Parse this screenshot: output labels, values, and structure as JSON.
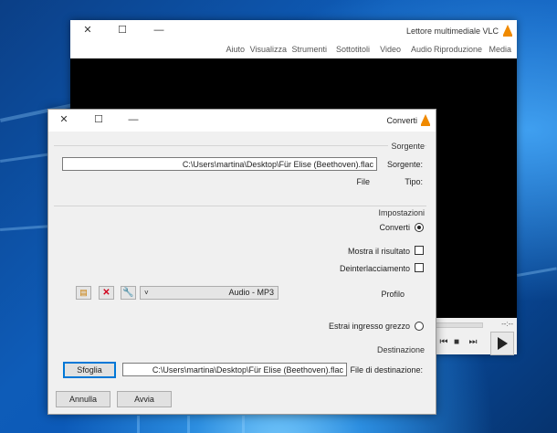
{
  "vlc_window": {
    "title": "Lettore multimediale VLC",
    "menu": [
      "Media",
      "Riproduzione",
      "Audio",
      "Video",
      "Sottotitoli",
      "Strumenti",
      "Visualizza",
      "Aiuto"
    ],
    "time_readout": "--:--"
  },
  "dialog": {
    "title": "Converti",
    "source": {
      "group_label": "Sorgente",
      "source_label": "Sorgente:",
      "source_value": "C:\\Users\\martina\\Desktop\\Für Elise (Beethoven).flac",
      "type_label": "Tipo:",
      "type_value": "File"
    },
    "settings": {
      "group_label": "Impostazioni",
      "convert_label": "Converti",
      "show_result_label": "Mostra il risultato",
      "deinterlace_label": "Deinterlacciamento",
      "profile_label": "Profilo",
      "profile_value": "Audio - MP3",
      "raw_input_label": "Estrai ingresso grezzo"
    },
    "destination": {
      "group_label": "Destinazione",
      "file_label": "File di destinazione:",
      "file_value": "C:\\Users\\martina\\Desktop\\Für Elise (Beethoven).flac",
      "browse_label": "Sfoglia"
    },
    "buttons": {
      "start_label": "Avvia",
      "cancel_label": "Annulla"
    }
  },
  "colors": {
    "accent": "#0078d7",
    "vlc_cone": "#f08a00",
    "delete_red": "#d0021b"
  }
}
